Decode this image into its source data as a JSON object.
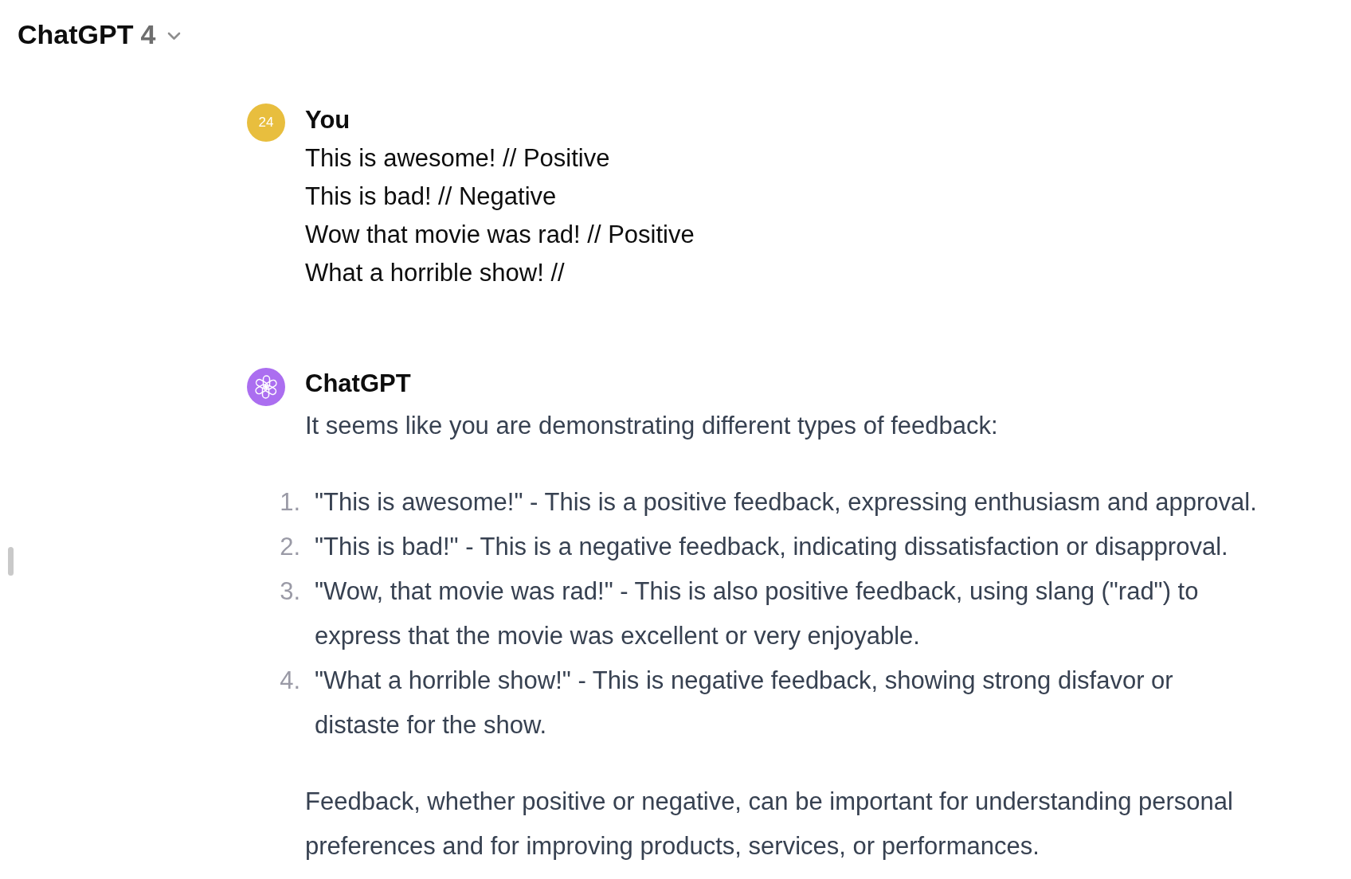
{
  "header": {
    "model_name": "ChatGPT",
    "model_version": "4"
  },
  "messages": [
    {
      "kind": "user",
      "avatar_text": "24",
      "author": "You",
      "lines": [
        "This is awesome! // Positive",
        "This is bad! // Negative",
        "Wow that movie was rad! // Positive",
        "What a horrible show! //"
      ]
    },
    {
      "kind": "assistant",
      "author": "ChatGPT",
      "intro": "It seems like you are demonstrating different types of feedback:",
      "list": [
        {
          "number": "1.",
          "text": "\"This is awesome!\" - This is a positive feedback, expressing enthusiasm and approval."
        },
        {
          "number": "2.",
          "text": "\"This is bad!\" - This is a negative feedback, indicating dissatisfaction or disapproval."
        },
        {
          "number": "3.",
          "text": "\"Wow, that movie was rad!\" - This is also positive feedback, using slang (\"rad\") to express that the movie was excellent or very enjoyable."
        },
        {
          "number": "4.",
          "text": "\"What a horrible show!\" - This is negative feedback, showing strong disfavor or distaste for the show."
        }
      ],
      "closing": "Feedback, whether positive or negative, can be important for understanding personal preferences and for improving products, services, or performances."
    }
  ]
}
